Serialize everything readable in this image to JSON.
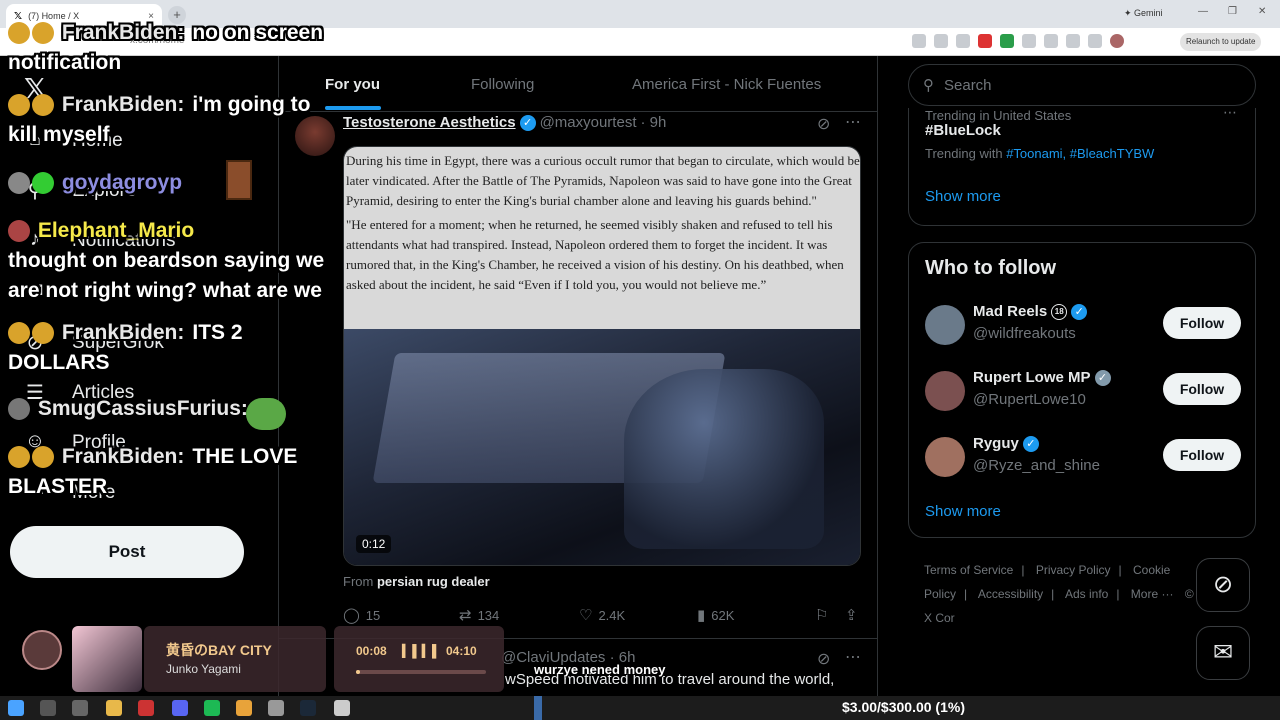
{
  "browser": {
    "tab_title": "(7) Home / X",
    "tab_close": "×",
    "new_tab": "+",
    "gemini_label": "✦ Gemini",
    "url": "x.com/home",
    "relaunch": "Relaunch to update",
    "window_controls": [
      "—",
      "❐",
      "✕"
    ]
  },
  "nav": {
    "items": [
      {
        "label": "Home",
        "icon": "home-icon"
      },
      {
        "label": "Explore",
        "icon": "search-icon"
      },
      {
        "label": "Notifications",
        "icon": "bell-icon"
      },
      {
        "label": "",
        "icon": "mail-icon"
      },
      {
        "label": "SuperGrok",
        "icon": "grok-icon"
      },
      {
        "label": "Articles",
        "icon": "articles-icon"
      },
      {
        "label": "Profile",
        "icon": "profile-icon"
      },
      {
        "label": "More",
        "icon": "more-icon"
      }
    ],
    "post_button": "Post"
  },
  "feed": {
    "tabs": [
      "For you",
      "Following",
      "America First - Nick Fuentes"
    ],
    "active_tab": 0,
    "tweet": {
      "name": "Testosterone Aesthetics",
      "handle": "@maxyourtest",
      "time": "· 9h",
      "text_p1": "During his time in Egypt, there was a curious occult rumor that began to circulate, which would be later vindicated. After the Battle of The Pyramids, Napoleon was said to have gone into the Great Pyramid, desiring to enter the King's burial chamber alone and leaving his guards behind.\"",
      "text_p2": "\"He entered for a moment; when he returned, he seemed visibly shaken and refused to tell his attendants what had transpired. Instead, Napoleon ordered them to forget the incident. It was rumored that, in the King's Chamber, he received a vision of his destiny. On his deathbed, when asked about the incident, he said “Even if I told you, you would not believe me.”",
      "video_duration": "0:12",
      "from_prefix": "From",
      "from_source": "persian rug dealer",
      "replies": "15",
      "reposts": "134",
      "likes": "2.4K",
      "views": "62K"
    },
    "tweet2": {
      "handle": "@ClaviUpdates · 6h",
      "text": "wSpeed motivated him to travel around the world,"
    }
  },
  "sidebar": {
    "search_placeholder": "Search",
    "trend_context": "Trending in United States",
    "trend_title": "#BlueLock",
    "trend_with_prefix": "Trending with",
    "trend_with_tags": "#Toonami, #BleachTYBW",
    "show_more": "Show more",
    "wtf_title": "Who to follow",
    "follow_label": "Follow",
    "suggestions": [
      {
        "name": "Mad Reels",
        "handle": "@wildfreakouts",
        "badge": "18",
        "verified": "blue",
        "avatar_color": "#6a7a8a"
      },
      {
        "name": "Rupert Lowe MP",
        "handle": "@RupertLowe10",
        "badge": "",
        "verified": "grey",
        "avatar_color": "#7b5050"
      },
      {
        "name": "Ryguy",
        "handle": "@Ryze_and_shine",
        "badge": "",
        "verified": "blue",
        "avatar_color": "#a07060"
      }
    ],
    "footer": [
      "Terms of Service",
      "|",
      "Privacy Policy",
      "|",
      "Cookie Policy",
      "|",
      "Accessibility",
      "|",
      "Ads info",
      "|",
      "More ···",
      "© 2026 X Cor"
    ]
  },
  "chat": [
    {
      "user": "FrankBiden:",
      "msg": "no on screen notification",
      "color": "gold"
    },
    {
      "user": "FrankBiden:",
      "msg": "i'm going to kill myself",
      "color": "gold"
    },
    {
      "user": "goydagroyp",
      "msg": "",
      "color": "purple"
    },
    {
      "user": "Elephant_Mario",
      "msg": "thought on beardson saying we are not right wing? what are we",
      "color": "yellow"
    },
    {
      "user": "FrankBiden:",
      "msg": "ITS 2 DOLLARS",
      "color": "gold"
    },
    {
      "user": "SmugCassiusFurius:",
      "msg": "",
      "color": "gold"
    },
    {
      "user": "FrankBiden:",
      "msg": "THE LOVE BLASTER",
      "color": "gold"
    }
  ],
  "music": {
    "title": "黄昏のBAY CITY",
    "artist": "Junko Yagami",
    "current": "00:08",
    "duration": "04:10",
    "progress": 0.03
  },
  "overlay_text": "wurzye nened money",
  "donation": "$3.00/$300.00 (1%)",
  "colors": {
    "accent": "#1d9bf0",
    "background": "#000000"
  }
}
